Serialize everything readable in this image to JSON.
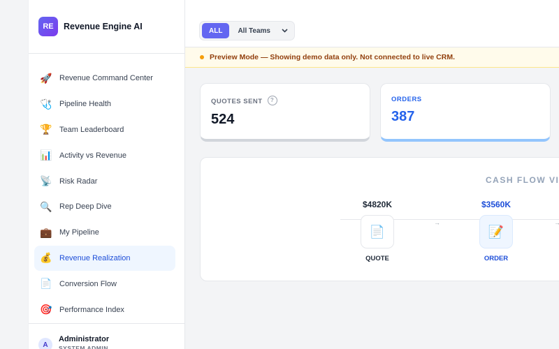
{
  "brand": {
    "initials": "RE",
    "name": "Revenue Engine AI"
  },
  "nav": {
    "items": [
      {
        "icon": "rocket-icon",
        "glyph": "🚀",
        "label": "Revenue Command Center"
      },
      {
        "icon": "pipeline-health-icon",
        "glyph": "🩺",
        "label": "Pipeline Health"
      },
      {
        "icon": "trophy-icon",
        "glyph": "🏆",
        "label": "Team Leaderboard"
      },
      {
        "icon": "bar-chart-icon",
        "glyph": "📊",
        "label": "Activity vs Revenue"
      },
      {
        "icon": "radar-icon",
        "glyph": "📡",
        "label": "Risk Radar"
      },
      {
        "icon": "magnifier-icon",
        "glyph": "🔍",
        "label": "Rep Deep Dive"
      },
      {
        "icon": "briefcase-icon",
        "glyph": "💼",
        "label": "My Pipeline"
      },
      {
        "icon": "money-bag-icon",
        "glyph": "💰",
        "label": "Revenue Realization",
        "active": true
      },
      {
        "icon": "document-flow-icon",
        "glyph": "📄",
        "label": "Conversion Flow"
      },
      {
        "icon": "target-icon",
        "glyph": "🎯",
        "label": "Performance Index"
      }
    ]
  },
  "user": {
    "initial": "A",
    "name": "Administrator",
    "role": "SYSTEM ADMIN"
  },
  "filters": {
    "all_label": "ALL",
    "team_label": "All Teams"
  },
  "banner": {
    "text": "Preview Mode — Showing demo data only. Not connected to live CRM."
  },
  "stats": {
    "quotes": {
      "label": "QUOTES SENT",
      "value": "524",
      "help": "?"
    },
    "orders": {
      "label": "ORDERS",
      "value": "387"
    }
  },
  "cashflow": {
    "title": "CASH FLOW VIS",
    "stages": [
      {
        "amount": "$4820K",
        "name": "QUOTE",
        "icon": "document-icon",
        "glyph": "📄",
        "color": "#1f2937"
      },
      {
        "amount": "$3560K",
        "name": "ORDER",
        "icon": "order-memo-icon",
        "glyph": "📝",
        "color": "#1d4ed8"
      }
    ],
    "arrow": "→"
  },
  "colors": {
    "accent": "#6366f1",
    "order_blue": "#2563eb",
    "banner_bg": "#fffbeb",
    "banner_text": "#92400e"
  }
}
